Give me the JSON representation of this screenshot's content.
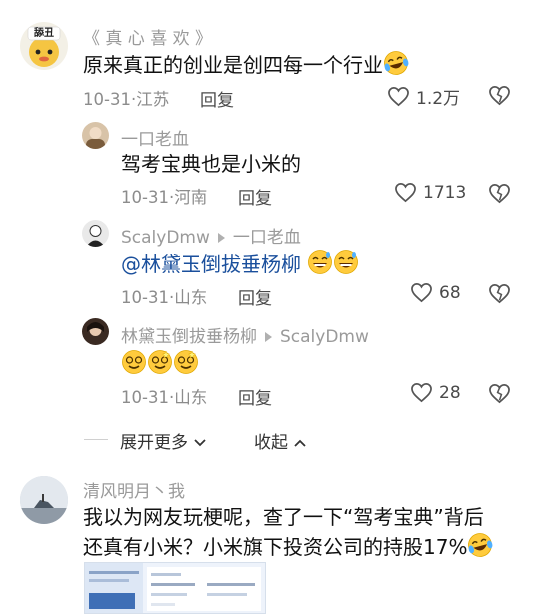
{
  "comments": [
    {
      "user": "《 真 心 喜 欢 》",
      "avatar_text": "舔丑",
      "text": "原来真正的创业是创四每一个行业",
      "date": "10-31",
      "location": "江苏",
      "reply_label": "回复",
      "likes": "1.2万"
    }
  ],
  "replies": [
    {
      "user": "一口老血",
      "text": "驾考宝典也是小米的",
      "date": "10-31",
      "location": "河南",
      "reply_label": "回复",
      "likes": "1713"
    },
    {
      "user": "ScalyDmw",
      "reply_to": "一口老血",
      "text": "@林黛玉倒拔垂杨柳",
      "date": "10-31",
      "location": "山东",
      "reply_label": "回复",
      "likes": "68"
    },
    {
      "user": "林黛玉倒拔垂杨柳",
      "reply_to": "ScalyDmw",
      "text": "",
      "date": "10-31",
      "location": "山东",
      "reply_label": "回复",
      "likes": "28"
    }
  ],
  "thread_controls": {
    "expand_label": "展开更多",
    "collapse_label": "收起"
  },
  "comment2": {
    "user": "清风明月丶我",
    "line1": "我以为网友玩梗呢，查了一下“驾考宝典”背后",
    "line2": "还真有小米？小米旗下投资公司的持股17%"
  },
  "icons": {
    "like": "heart-outline-icon",
    "dislike": "broken-heart-icon",
    "laugh": "tears-of-joy-emoji",
    "grin": "grinning-sweat-emoji",
    "dizzy": "dizzy-face-emoji"
  }
}
